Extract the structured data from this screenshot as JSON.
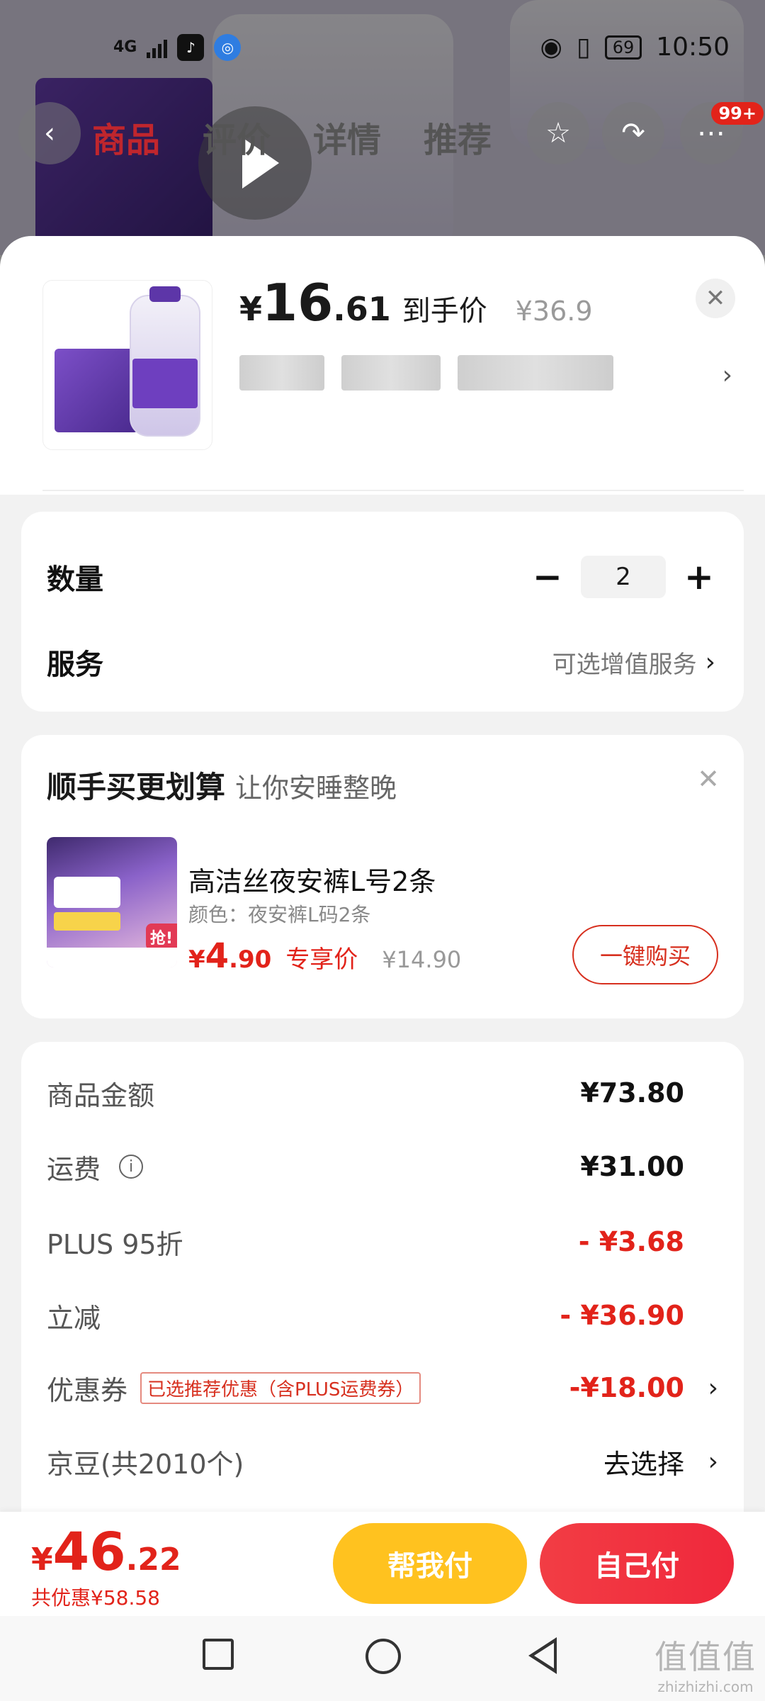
{
  "status_bar": {
    "network": "4G",
    "time": "10:50",
    "battery": "69"
  },
  "top_nav": {
    "tabs": [
      "商品",
      "评价",
      "详情",
      "推荐"
    ],
    "badge": "99+"
  },
  "product": {
    "price_yen": "¥",
    "price_int": "16",
    "price_dec": ".61",
    "price_label": "到手价",
    "original_price": "¥36.9"
  },
  "options": {
    "quantity_label": "数量",
    "quantity": "2",
    "minus": "−",
    "plus": "+",
    "service_label": "服务",
    "service_value": "可选增值服务"
  },
  "upsell": {
    "title": "顺手买更划算",
    "subtitle": "让你安睡整晚",
    "item_name": "高洁丝夜安裤L号2条",
    "item_spec": "颜色：夜安裤L码2条",
    "price_yen": "¥",
    "price_int": "4",
    "price_dec": ".90",
    "price_label": "专享价",
    "original_price": "¥14.90",
    "buy_button": "一键购买",
    "image_badge": "抢!"
  },
  "fees": {
    "rows": [
      {
        "label": "商品金额",
        "value": "¥73.80"
      },
      {
        "label": "运费",
        "value": "¥31.00"
      },
      {
        "label": "PLUS 95折",
        "value": "- ¥3.68"
      },
      {
        "label": "立减",
        "value": "- ¥36.90"
      },
      {
        "label": "优惠券",
        "value": "-¥18.00",
        "tag": "已选推荐优惠（含PLUS运费券）"
      },
      {
        "label": "京豆(共2010个)",
        "value": "去选择"
      }
    ]
  },
  "pay_bar": {
    "total_yen": "¥",
    "total_int": "46",
    "total_dec": ".22",
    "saved": "共优惠¥58.58",
    "help_pay": "帮我付",
    "self_pay": "自己付"
  },
  "watermark": {
    "logo": "值值值",
    "url": "zhizhizhi.com"
  },
  "colors": {
    "accent_red": "#e2231a",
    "help_yellow": "#ffc21f",
    "brand_purple": "#6e3fbf"
  },
  "icons": {
    "back": "chevron-left-icon",
    "star": "star-icon",
    "share": "share-icon",
    "more": "more-icon",
    "close": "close-icon",
    "info": "info-icon"
  }
}
